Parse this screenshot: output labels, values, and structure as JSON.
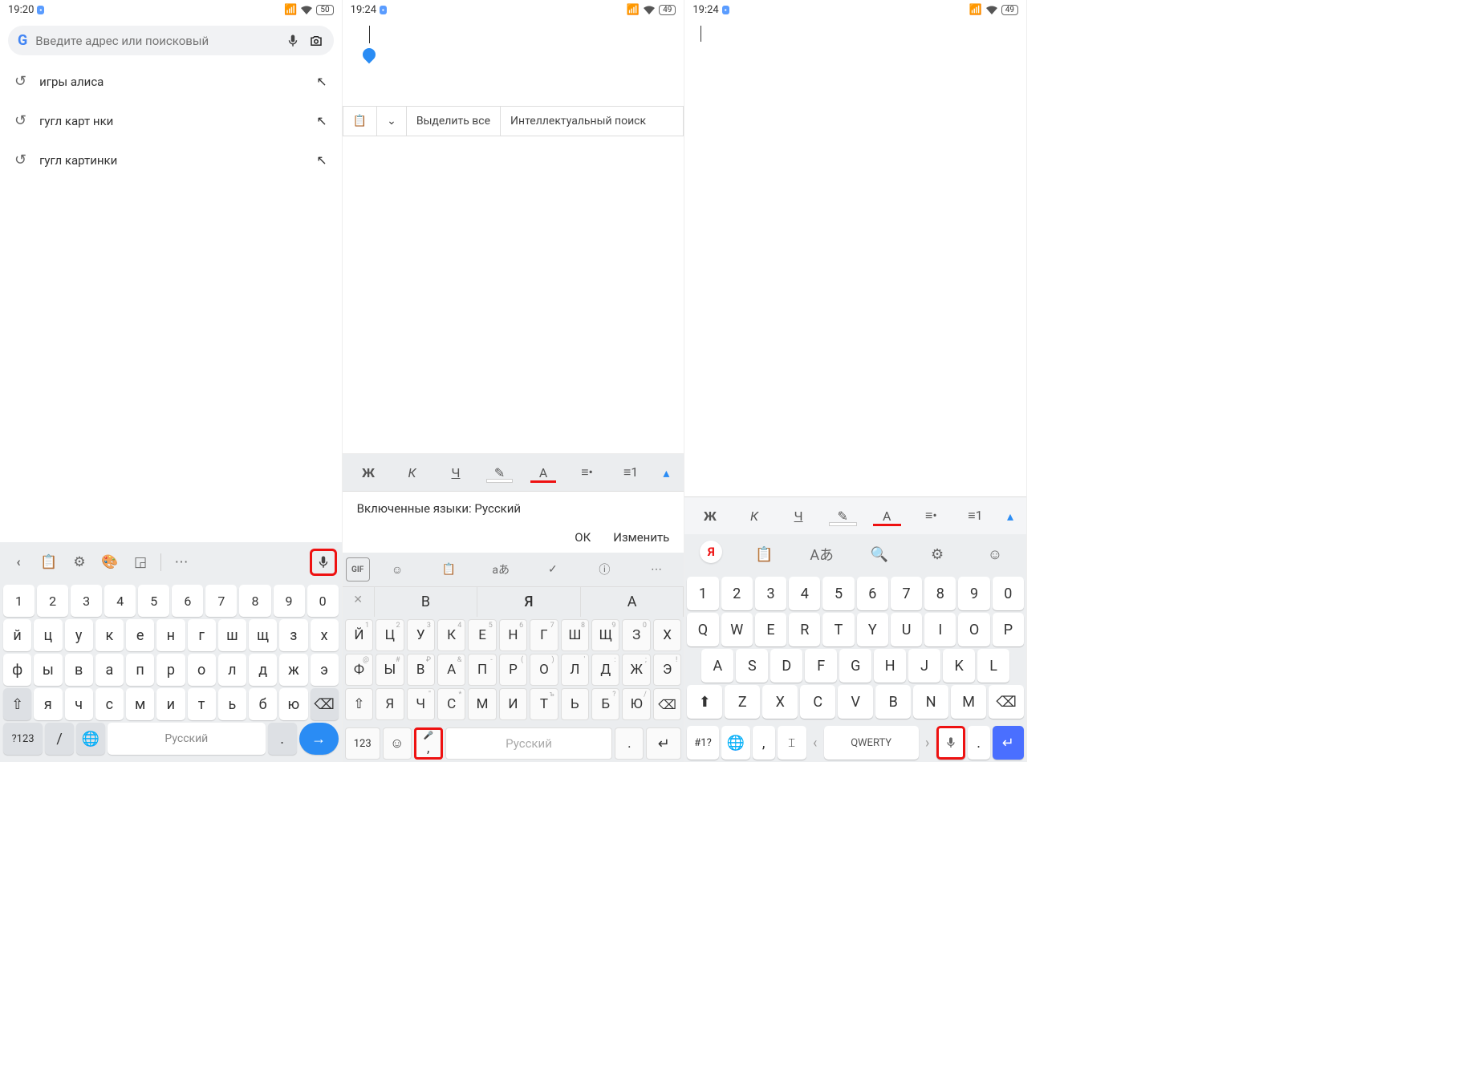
{
  "panel1": {
    "status": {
      "time": "19:20",
      "battery": "50"
    },
    "search_placeholder": "Введите адрес или поисковый",
    "suggestions": [
      "игры алиса",
      "гугл карт нки",
      "гугл картинки"
    ],
    "kb": {
      "row_num": [
        "1",
        "2",
        "3",
        "4",
        "5",
        "6",
        "7",
        "8",
        "9",
        "0"
      ],
      "row1": [
        "й",
        "ц",
        "у",
        "к",
        "е",
        "н",
        "г",
        "ш",
        "щ",
        "з",
        "х"
      ],
      "row2": [
        "ф",
        "ы",
        "в",
        "а",
        "п",
        "р",
        "о",
        "л",
        "д",
        "ж",
        "э"
      ],
      "row3": [
        "я",
        "ч",
        "с",
        "м",
        "и",
        "т",
        "ь",
        "б",
        "ю"
      ],
      "sym": "?123",
      "slash": "/",
      "space": "Русский",
      "dot": "."
    }
  },
  "panel2": {
    "status": {
      "time": "19:24",
      "battery": "49"
    },
    "ctx": {
      "select_all": "Выделить все",
      "smart": "Интеллектуальный поиск"
    },
    "fmt": {
      "bold": "Ж",
      "italic": "К",
      "underline": "Ч",
      "fontcolor": "А"
    },
    "dialog": {
      "title": "Включенные языки: Русский",
      "ok": "ОК",
      "edit": "Изменить"
    },
    "kb": {
      "gif": "GIF",
      "sugg": [
        "В",
        "Я",
        "А"
      ],
      "row1": [
        [
          "Й",
          "1"
        ],
        [
          "Ц",
          "2"
        ],
        [
          "У",
          "3"
        ],
        [
          "К",
          "4"
        ],
        [
          "Е",
          "5"
        ],
        [
          "Н",
          "6"
        ],
        [
          "Г",
          "7"
        ],
        [
          "Ш",
          "8"
        ],
        [
          "Щ",
          "9"
        ],
        [
          "З",
          "0"
        ],
        [
          "Х",
          ""
        ]
      ],
      "row2": [
        [
          "Ф",
          "@"
        ],
        [
          "Ы",
          "#"
        ],
        [
          "В",
          "₽"
        ],
        [
          "А",
          "&"
        ],
        [
          "П",
          "-"
        ],
        [
          "Р",
          "("
        ],
        [
          "О",
          ")"
        ],
        [
          "Л",
          "'"
        ],
        [
          "Д",
          ":"
        ],
        [
          "Ж",
          ";"
        ],
        [
          "Э",
          "!"
        ]
      ],
      "row3": [
        [
          "Я",
          ""
        ],
        [
          "Ч",
          "\""
        ],
        [
          "С",
          "*"
        ],
        [
          "М",
          ""
        ],
        [
          "И",
          ""
        ],
        [
          "Т",
          "ъ"
        ],
        [
          "Ь",
          ""
        ],
        [
          "Б",
          "?"
        ],
        [
          "Ю",
          "/"
        ]
      ],
      "num": "123",
      "space": "Русский",
      "dot": ".",
      "comma": ","
    }
  },
  "panel3": {
    "status": {
      "time": "19:24",
      "battery": "49"
    },
    "fmt": {
      "bold": "Ж",
      "italic": "К",
      "underline": "Ч",
      "fontcolor": "А"
    },
    "kb": {
      "ya": "Я",
      "row_num": [
        "1",
        "2",
        "3",
        "4",
        "5",
        "6",
        "7",
        "8",
        "9",
        "0"
      ],
      "row1": [
        "Q",
        "W",
        "E",
        "R",
        "T",
        "Y",
        "U",
        "I",
        "O",
        "P"
      ],
      "row2": [
        "A",
        "S",
        "D",
        "F",
        "G",
        "H",
        "J",
        "K",
        "L"
      ],
      "row3": [
        "Z",
        "X",
        "C",
        "V",
        "B",
        "N",
        "M"
      ],
      "sym": "#1?",
      "comma": ",",
      "space": "QWERTY",
      "dot": "."
    }
  }
}
